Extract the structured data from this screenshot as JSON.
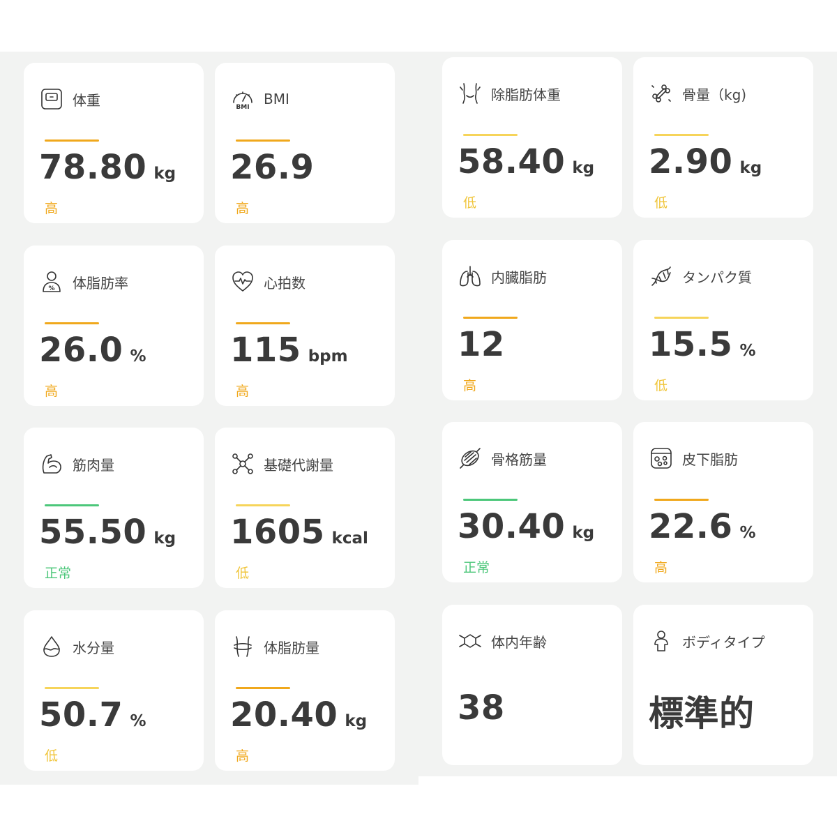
{
  "cards": [
    {
      "id": "weight",
      "label": "体重",
      "icon": "scale-icon",
      "value": "78.80",
      "unit": "kg",
      "status": "高",
      "bar_color": "#f0a81c",
      "status_color": "#f0a81c"
    },
    {
      "id": "bmi",
      "label": "BMI",
      "icon": "bmi-gauge-icon",
      "value": "26.9",
      "unit": "",
      "status": "高",
      "bar_color": "#f0a81c",
      "status_color": "#f0a81c",
      "icon_text": "BMI"
    },
    {
      "id": "lean-mass",
      "label": "除脂肪体重",
      "icon": "torso-icon",
      "value": "58.40",
      "unit": "kg",
      "status": "低",
      "bar_color": "#f6d45a",
      "status_color": "#f0c53a"
    },
    {
      "id": "bone-mass",
      "label": "骨量（kg)",
      "icon": "bone-icon",
      "value": "2.90",
      "unit": "kg",
      "status": "低",
      "bar_color": "#f6d45a",
      "status_color": "#f0c53a"
    },
    {
      "id": "body-fat-rate",
      "label": "体脂肪率",
      "icon": "body-fat-person-icon",
      "value": "26.0",
      "unit": "%",
      "status": "高",
      "bar_color": "#f0a81c",
      "status_color": "#f0a81c",
      "icon_text": "%"
    },
    {
      "id": "heart-rate",
      "label": "心拍数",
      "icon": "heart-rate-icon",
      "value": "115",
      "unit": "bpm",
      "status": "高",
      "bar_color": "#f0a81c",
      "status_color": "#f0a81c"
    },
    {
      "id": "visceral-fat",
      "label": "内臓脂肪",
      "icon": "lungs-icon",
      "value": "12",
      "unit": "",
      "status": "高",
      "bar_color": "#f0a81c",
      "status_color": "#f0a81c"
    },
    {
      "id": "protein",
      "label": "タンパク質",
      "icon": "dna-icon",
      "value": "15.5",
      "unit": "%",
      "status": "低",
      "bar_color": "#f6d45a",
      "status_color": "#f0c53a"
    },
    {
      "id": "muscle-mass",
      "label": "筋肉量",
      "icon": "bicep-icon",
      "value": "55.50",
      "unit": "kg",
      "status": "正常",
      "bar_color": "#4cc77a",
      "status_color": "#4cc77a"
    },
    {
      "id": "bmr",
      "label": "基礎代謝量",
      "icon": "molecule-icon",
      "value": "1605",
      "unit": "kcal",
      "status": "低",
      "bar_color": "#f6d45a",
      "status_color": "#f0c53a"
    },
    {
      "id": "skeletal-muscle",
      "label": "骨格筋量",
      "icon": "muscle-fiber-icon",
      "value": "30.40",
      "unit": "kg",
      "status": "正常",
      "bar_color": "#4cc77a",
      "status_color": "#4cc77a"
    },
    {
      "id": "subcutaneous-fat",
      "label": "皮下脂肪",
      "icon": "fat-cells-icon",
      "value": "22.6",
      "unit": "%",
      "status": "高",
      "bar_color": "#f0a81c",
      "status_color": "#f0a81c"
    },
    {
      "id": "water",
      "label": "水分量",
      "icon": "water-drop-icon",
      "value": "50.7",
      "unit": "%",
      "status": "低",
      "bar_color": "#f6d45a",
      "status_color": "#f0c53a"
    },
    {
      "id": "body-fat-mass",
      "label": "体脂肪量",
      "icon": "waist-icon",
      "value": "20.40",
      "unit": "kg",
      "status": "高",
      "bar_color": "#f0a81c",
      "status_color": "#f0a81c"
    },
    {
      "id": "body-age",
      "label": "体内年齢",
      "icon": "hexagon-body-icon",
      "value": "38",
      "unit": "",
      "status": "",
      "bar_color": "",
      "status_color": ""
    },
    {
      "id": "body-type",
      "label": "ボディタイプ",
      "icon": "person-icon",
      "value": "標準的",
      "unit": "",
      "status": "",
      "bar_color": "",
      "status_color": ""
    }
  ]
}
